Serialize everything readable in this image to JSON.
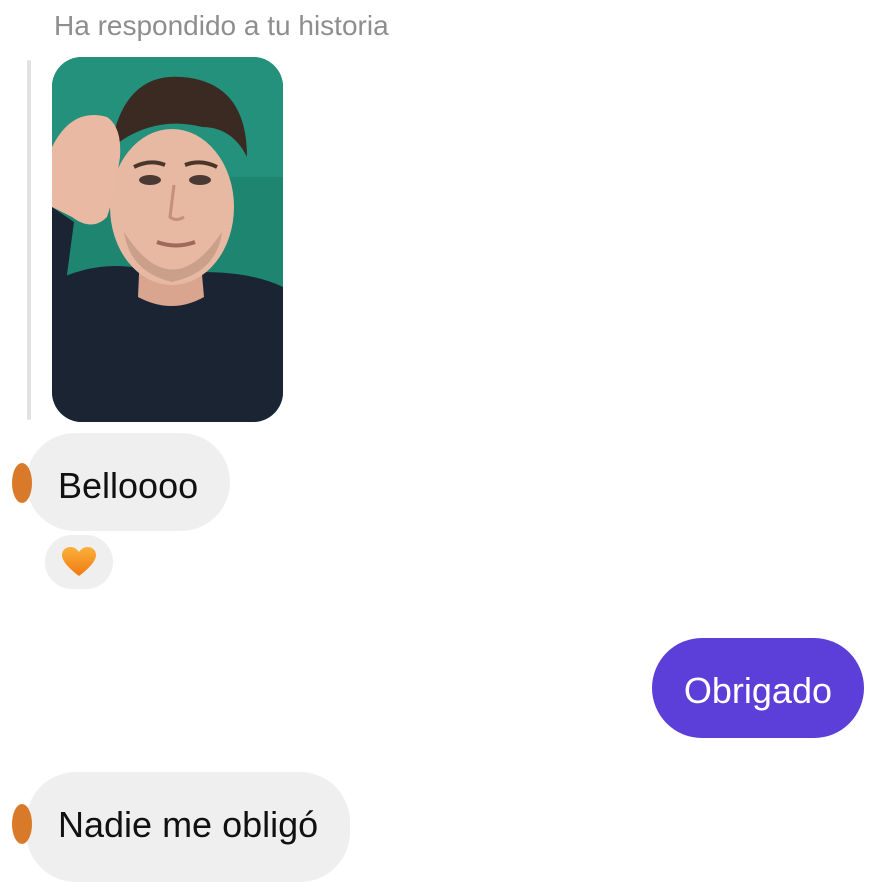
{
  "story_reply": {
    "label": "Ha respondido a tu historia"
  },
  "messages": [
    {
      "direction": "incoming",
      "text": "Belloooo"
    },
    {
      "direction": "outgoing",
      "text": "Obrigado"
    },
    {
      "direction": "incoming",
      "text": "Nadie me obligó"
    }
  ],
  "reaction": {
    "icon": "orange-heart-icon",
    "color": "#f5a623"
  },
  "colors": {
    "outgoing_bubble": "#5b3fd8",
    "incoming_bubble": "#efefef",
    "muted_text": "#8e8e8e",
    "avatar": "#d97a2a"
  }
}
